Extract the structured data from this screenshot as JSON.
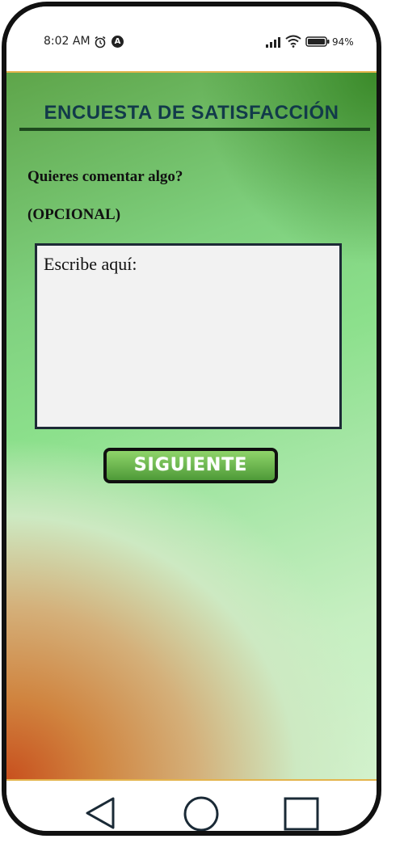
{
  "status_bar": {
    "time": "8:02 AM",
    "alarm_icon": "alarm-clock-icon",
    "app_icon_letter": "A",
    "signal_icon": "cell-signal-icon",
    "wifi_icon": "wifi-icon",
    "battery_icon": "battery-icon",
    "battery_percent": "94%"
  },
  "survey": {
    "title": "ENCUESTA DE SATISFACCIÓN",
    "question": "Quieres comentar algo?",
    "optional_label": "(OPCIONAL)",
    "comment_placeholder": "Escribe aquí:",
    "comment_value": "",
    "next_label": "SIGUIENTE"
  },
  "nav_bar": {
    "back_icon": "back-triangle-icon",
    "home_icon": "home-circle-icon",
    "recents_icon": "recents-square-icon"
  },
  "colors": {
    "title": "#123a4a",
    "rule": "#1e4a1e",
    "button_green": "#4e9a38",
    "box_border": "#1d2a36",
    "accent_border": "#e4b44c"
  }
}
